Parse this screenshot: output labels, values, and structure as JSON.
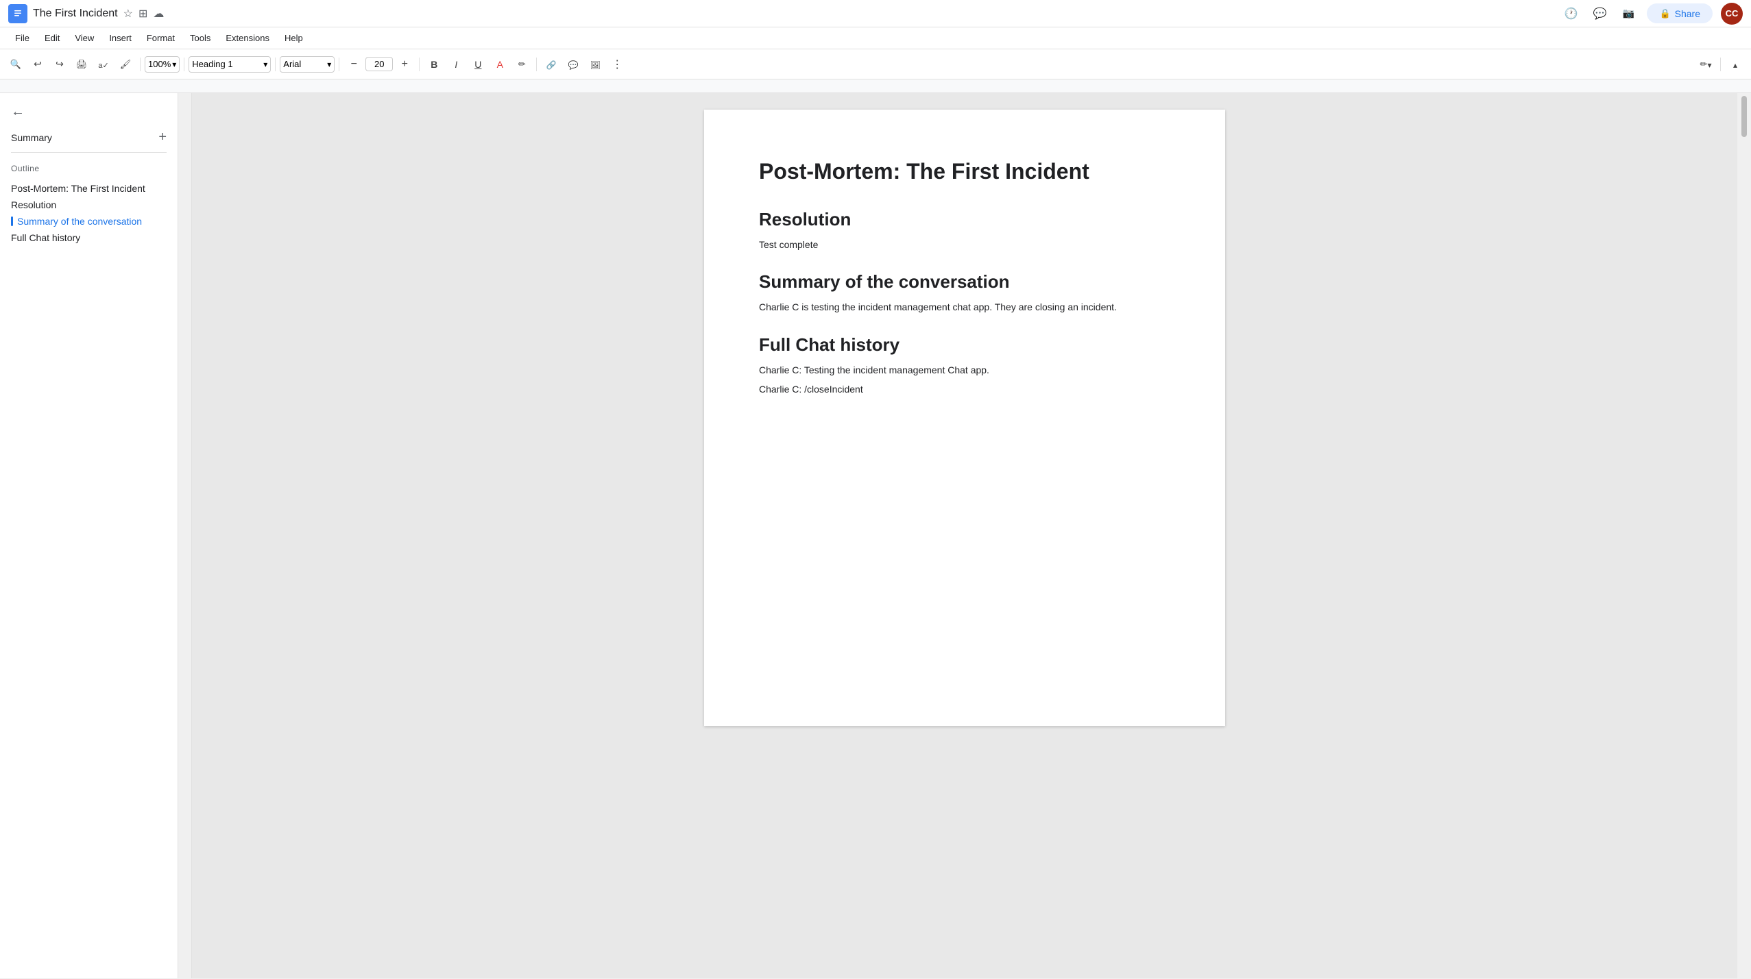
{
  "titlebar": {
    "doc_title": "The First Incident",
    "star_icon": "star-icon",
    "folder_icon": "folder-icon",
    "cloud_icon": "cloud-icon",
    "share_label": "Share",
    "history_icon": "history-icon",
    "chat_icon": "chat-icon",
    "camera_icon": "camera-icon"
  },
  "menu": {
    "items": [
      "File",
      "Edit",
      "View",
      "Insert",
      "Format",
      "Tools",
      "Extensions",
      "Help"
    ]
  },
  "toolbar": {
    "zoom": "100%",
    "style": "Heading 1",
    "font": "Arial",
    "font_size": "20",
    "more_options": "⋯"
  },
  "sidebar": {
    "back_label": "←",
    "section_title": "Summary",
    "outline_label": "Outline",
    "outline_items": [
      {
        "id": 1,
        "text": "Post-Mortem: The First Incident",
        "active": false
      },
      {
        "id": 2,
        "text": "Resolution",
        "active": false
      },
      {
        "id": 3,
        "text": "Summary of the conversation",
        "active": true
      },
      {
        "id": 4,
        "text": "Full Chat history",
        "active": false
      }
    ]
  },
  "document": {
    "title": "Post-Mortem: The First Incident",
    "sections": [
      {
        "heading": "Resolution",
        "body": "Test complete"
      },
      {
        "heading": "Summary of the conversation",
        "body": "Charlie C is testing the incident management chat app. They are closing an incident."
      },
      {
        "heading": "Full Chat history",
        "lines": [
          "Charlie C: Testing the incident management Chat app.",
          "Charlie C: /closeIncident"
        ]
      }
    ]
  }
}
